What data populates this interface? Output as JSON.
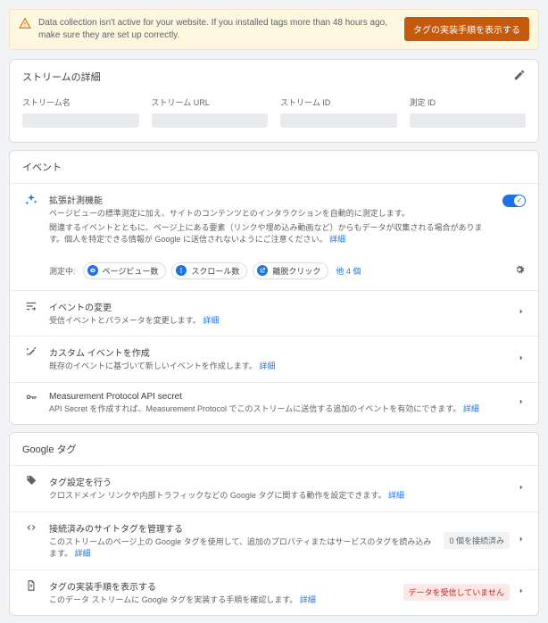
{
  "warning": {
    "text": "Data collection isn't active for your website. If you installed tags more than 48 hours ago, make sure they are set up correctly.",
    "button": "タグの実装手順を表示する"
  },
  "stream": {
    "title": "ストリームの詳細",
    "cols": {
      "name": "ストリーム名",
      "url": "ストリーム URL",
      "id": "ストリーム ID",
      "measure": "測定 ID"
    }
  },
  "events": {
    "title": "イベント",
    "enhanced": {
      "title": "拡張計測機能",
      "desc1": "ページビューの標準測定に加え、サイトのコンテンツとのインタラクションを自動的に測定します。",
      "desc2": "関連するイベントとともに、ページ上にある要素（リンクや埋め込み動画など）からもデータが収集される場合があります。個人を特定できる情報が Google に送信されないようにご注意ください。",
      "detail": "詳細"
    },
    "chipsLabel": "測定中:",
    "chips": {
      "pv": "ページビュー数",
      "scroll": "スクロール数",
      "out": "離脱クリック"
    },
    "more": "他 4 個",
    "modify": {
      "title": "イベントの変更",
      "desc": "受信イベントとパラメータを変更します。",
      "detail": "詳細"
    },
    "custom": {
      "title": "カスタム イベントを作成",
      "desc": "既存のイベントに基づいて新しいイベントを作成します。",
      "detail": "詳細"
    },
    "mp": {
      "title": "Measurement Protocol API secret",
      "desc": "API Secret を作成すれば、Measurement Protocol でこのストリームに送信する追加のイベントを有効にできます。",
      "detail": "詳細"
    }
  },
  "gtag": {
    "title": "Google タグ",
    "config": {
      "title": "タグ設定を行う",
      "desc": "クロスドメイン リンクや内部トラフィックなどの Google タグに関する動作を設定できます。",
      "detail": "詳細"
    },
    "connected": {
      "title": "接続済みのサイトタグを管理する",
      "desc": "このストリームのページ上の Google タグを使用して、追加のプロパティまたはサービスのタグを読み込みます。",
      "detail": "詳細",
      "badge": "0 個を接続済み"
    },
    "install": {
      "title": "タグの実装手順を表示する",
      "desc": "このデータ ストリームに Google タグを実装する手順を確認します。",
      "detail": "詳細",
      "badge": "データを受信していません"
    }
  }
}
